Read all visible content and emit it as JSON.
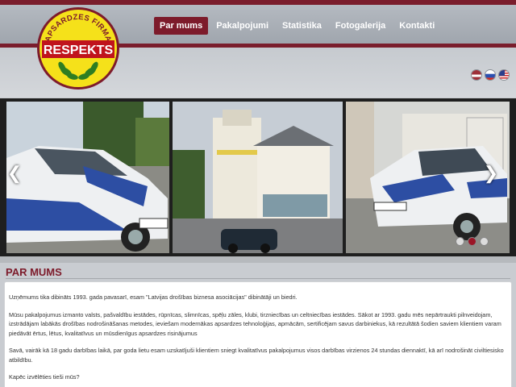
{
  "logo": {
    "arc_text": "APSARDZES FIRMA",
    "name": "RESPEKTS"
  },
  "nav": {
    "items": [
      {
        "label": "Par mums",
        "active": true
      },
      {
        "label": "Pakalpojumi",
        "active": false
      },
      {
        "label": "Statistika",
        "active": false
      },
      {
        "label": "Fotogalerija",
        "active": false
      },
      {
        "label": "Kontakti",
        "active": false
      }
    ]
  },
  "languages": [
    "latvian-flag-icon",
    "russian-flag-icon",
    "us-flag-icon"
  ],
  "slider": {
    "prev_icon": "chevron-left-icon",
    "next_icon": "chevron-right-icon",
    "dot_count": 3,
    "active_dot": 2
  },
  "page": {
    "title": "PAR MUMS",
    "paragraphs": [
      "Uzņēmums tika dibināts 1993. gada pavasarī, esam \"Latvijas drošības biznesa asociācijas\" dibinātāji  un biedri.",
      "Mūsu pakalpojumus izmanto valsts, pašvaldību iestādes, rūpnīcas, slimnīcas, spēļu zāles, klubi, tirzniecības un celtniecības iestādes. Sākot ar 1993. gadu mēs nepārtraukti pilnveidojam, izstrādājam labākās drošības nodrošināšanas metodes, ieviešam modernākas apsardzes tehnoloģijas, apmācām, sertificējam savus darbiniekus, kā rezultātā šodien saviem klientiem varam piedāvāt ērtus, lētus, kvalitatīvus un mūsdienīgus apsardzes risinājumus",
      "Savā, vairāk kā 18 gadu darbības laikā, par goda lietu esam uzskatījuši klientiem sniegt kvalitatīvus pakalpojumus visos darbības virzienos 24 stundas diennaktī, kā arī nodrošināt civiltiesisko atbildību.",
      "Kapēc izvēlēties tieši mūs?"
    ]
  },
  "colors": {
    "brand": "#7d1b2b",
    "logo_yellow": "#f5e11a",
    "logo_red": "#c0141c"
  }
}
